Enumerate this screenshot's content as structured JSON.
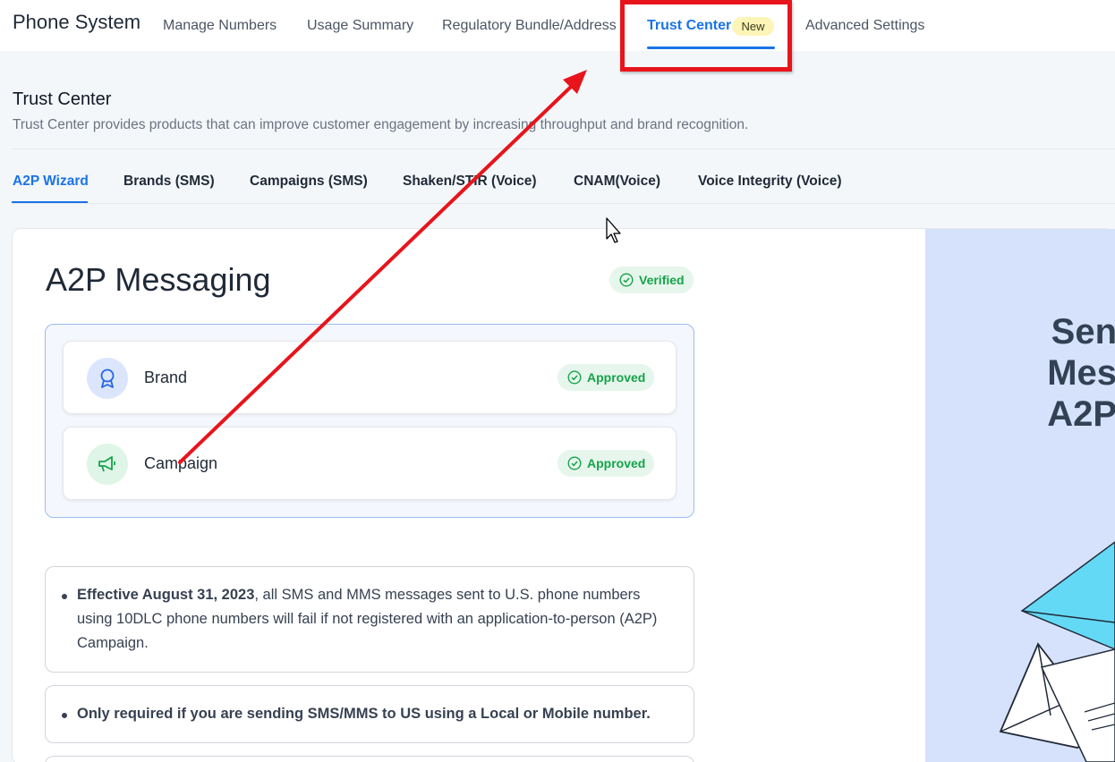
{
  "header": {
    "app_title": "Phone System",
    "nav": [
      {
        "label": "Manage Numbers"
      },
      {
        "label": "Usage Summary"
      },
      {
        "label": "Regulatory Bundle/Address"
      },
      {
        "label": "Trust Center",
        "badge": "New",
        "active": true
      },
      {
        "label": "Advanced Settings"
      }
    ]
  },
  "section": {
    "title": "Trust Center",
    "description": "Trust Center provides products that can improve customer engagement by increasing throughput and brand recognition.",
    "tabs": [
      {
        "label": "A2P Wizard",
        "active": true
      },
      {
        "label": "Brands (SMS)"
      },
      {
        "label": "Campaigns (SMS)"
      },
      {
        "label": "Shaken/STIR (Voice)"
      },
      {
        "label": "CNAM(Voice)"
      },
      {
        "label": "Voice Integrity (Voice)"
      }
    ]
  },
  "card": {
    "title": "A2P Messaging",
    "status": "Verified",
    "steps": [
      {
        "label": "Brand",
        "status": "Approved",
        "icon": "award-ribbon-icon"
      },
      {
        "label": "Campaign",
        "status": "Approved",
        "icon": "megaphone-icon"
      }
    ],
    "notes": [
      {
        "bold": "Effective August 31, 2023",
        "text": ", all SMS and MMS messages sent to U.S. phone numbers using 10DLC phone numbers will fail if not registered with an application-to-person (A2P) Campaign."
      },
      {
        "bold": "Only required if you are sending SMS/MMS to US using a Local or Mobile number.",
        "text": ""
      }
    ]
  },
  "promo": {
    "text_lines": [
      "Sen",
      "Mes",
      "A2P"
    ]
  },
  "colors": {
    "accent": "#1a73e8",
    "annotation_red": "#e8141b",
    "approved_green": "#16a34a",
    "promo_bg": "#d6e2fb"
  }
}
